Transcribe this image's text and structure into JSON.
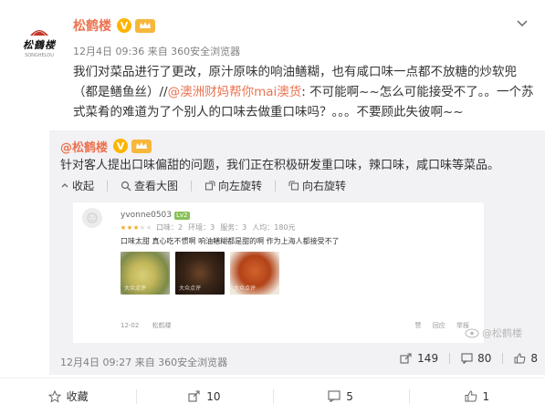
{
  "post": {
    "avatar_logo_text": "松鶴楼",
    "avatar_logo_sub": "SONGHELOU",
    "user_name": "松鹤楼",
    "verified_mark": "V",
    "meta": "12月4日 09:36 来自 360安全浏览器",
    "content": {
      "part1": "我们对菜品进行了更改，原汁原味的响油鳝糊，也有咸口味一点都不放糖的炒软兜（都是鳝鱼丝）//",
      "mention": "@澳洲财妈帮你mai澳货",
      "part2": ": 不可能啊~~怎么可能接受不了。。一个苏式菜肴的难道为了个别人的口味去做重口味吗？。。。不要顾此失彼啊~~"
    }
  },
  "repost": {
    "user_name": "@松鹤楼",
    "verified_mark": "V",
    "text": "针对客人提出口味偏甜的问题，我们正在积极研发重口味，辣口味，咸口味等菜品。",
    "toolbar": {
      "collapse": "收起",
      "view_large": "查看大图",
      "rotate_left": "向左旋转",
      "rotate_right": "向右旋转"
    },
    "image": {
      "user": "yvonne0503",
      "level": "Lv2",
      "stars": 3,
      "rating": {
        "taste": "口味：2",
        "env": "环境：3",
        "service": "服务：3",
        "price": "人均：180元"
      },
      "review": "口味太甜 真心吃不惯啊 响油鳝糊都是甜的啊 作为上海人都接受不了",
      "photo_watermark": "大众点评",
      "date": "12-02",
      "shop": "松鹤楼",
      "actions": [
        "赞",
        "回应",
        "举报"
      ]
    },
    "watermark": "@松鹤楼",
    "meta": "12月4日 09:27 来自 360安全浏览器",
    "shares": "149",
    "comments": "80",
    "likes": "8"
  },
  "bottom": {
    "favorite": "收藏",
    "share_count": "10",
    "comment_count": "5",
    "like_count": "1"
  }
}
